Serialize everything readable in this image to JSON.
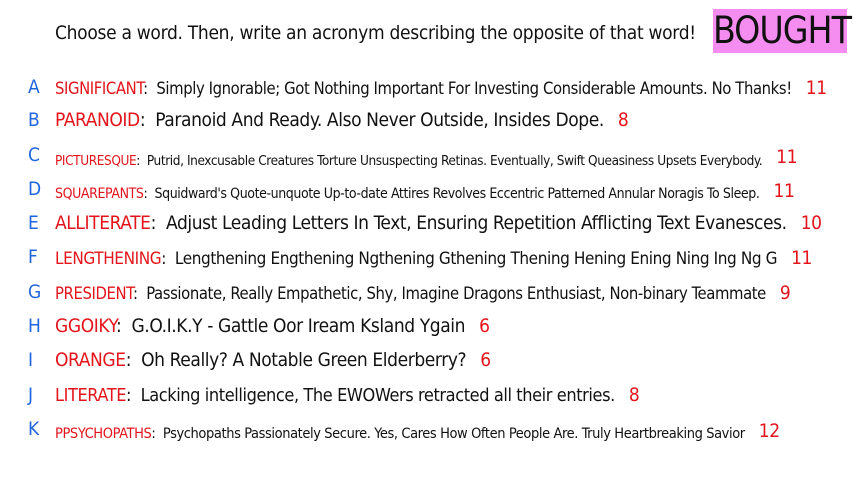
{
  "prompt": "Choose a word. Then, write an acronym describing the opposite of that word!",
  "title_word": "BOUGHT",
  "colors": {
    "letter": "#2266dd",
    "word": "#e3141b",
    "score": "#e3141b",
    "badge": "#f58cf0"
  },
  "entries": [
    {
      "letter": "A",
      "word": "SIGNIFICANT",
      "definition": "Simply Ignorable; Got Nothing Important For Investing Considerable Amounts. No Thanks!",
      "score": "11"
    },
    {
      "letter": "B",
      "word": "PARANOID",
      "definition": "Paranoid And Ready. Also Never Outside, Insides Dope.",
      "score": "8"
    },
    {
      "letter": "C",
      "word": "PICTURESQUE",
      "definition": "Putrid, Inexcusable Creatures Torture Unsuspecting Retinas. Eventually, Swift Queasiness Upsets Everybody.",
      "score": "11"
    },
    {
      "letter": "D",
      "word": "SQUAREPANTS",
      "definition": "Squidward's Quote-unquote Up-to-date Attires Revolves Eccentric Patterned Annular Noragis To Sleep.",
      "score": "11"
    },
    {
      "letter": "E",
      "word": "ALLITERATE",
      "definition": "Adjust Leading Letters In Text, Ensuring Repetition Afflicting Text Evanesces.",
      "score": "10"
    },
    {
      "letter": "F",
      "word": "LENGTHENING",
      "definition": "Lengthening Engthening Ngthening Gthening Thening Hening Ening Ning Ing Ng G",
      "score": "11"
    },
    {
      "letter": "G",
      "word": "PRESIDENT",
      "definition": "Passionate, Really Empathetic, Shy, Imagine Dragons Enthusiast, Non-binary Teammate",
      "score": "9"
    },
    {
      "letter": "H",
      "word": "GGOIKY",
      "definition": "G.O.I.K.Y - Gattle Oor Iream Ksland Ygain",
      "score": "6"
    },
    {
      "letter": "I",
      "word": "ORANGE",
      "definition": "Oh Really? A Notable Green Elderberry?",
      "score": "6"
    },
    {
      "letter": "J",
      "word": "LITERATE",
      "definition": "Lacking intelligence, The EWOWers retracted all their entries.",
      "score": "8"
    },
    {
      "letter": "K",
      "word": "PPSYCHOPATHS",
      "definition": "Psychopaths Passionately Secure. Yes, Cares How Often People Are. Truly Heartbreaking Savior",
      "score": "12"
    }
  ]
}
